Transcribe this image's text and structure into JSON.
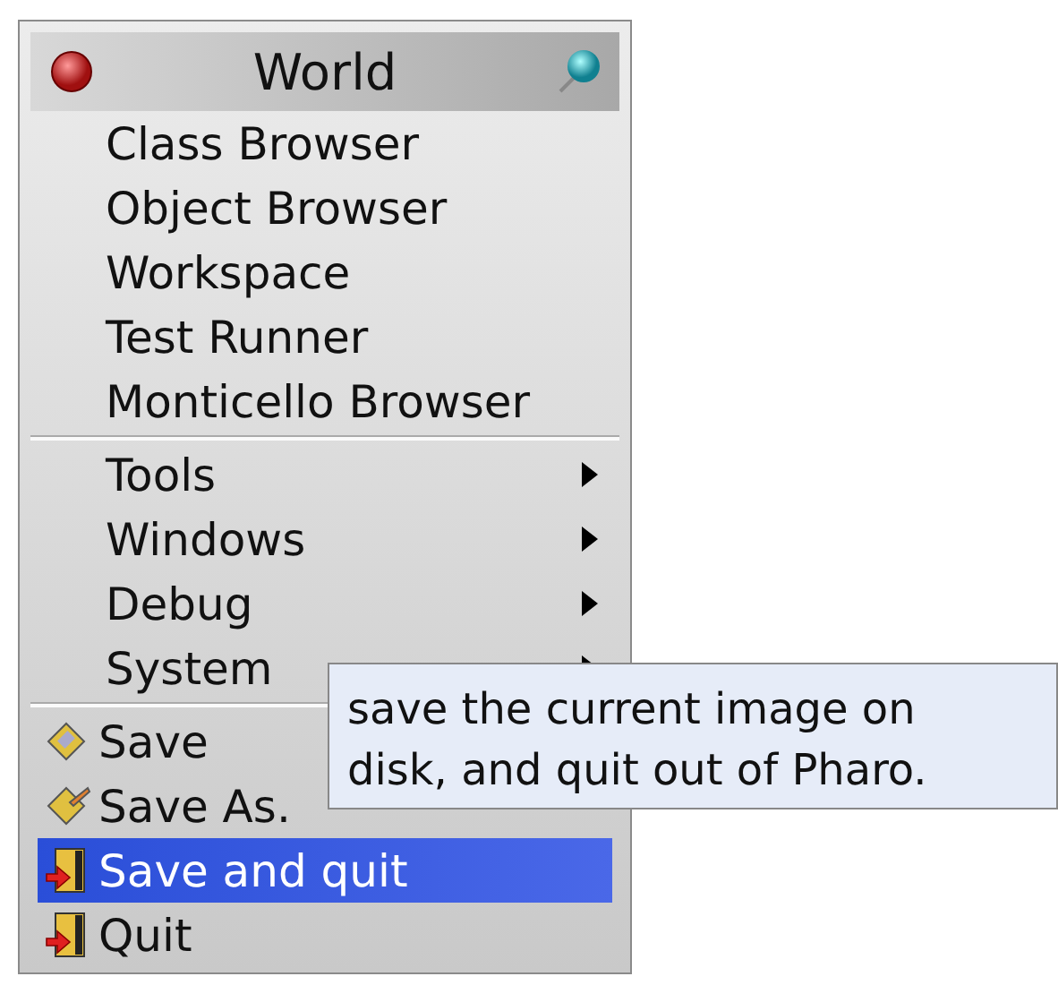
{
  "menu": {
    "title": "World",
    "groups": [
      {
        "items": [
          {
            "label": "Class Browser",
            "kind": "plain",
            "selected": false
          },
          {
            "label": "Object Browser",
            "kind": "plain",
            "selected": false
          },
          {
            "label": "Workspace",
            "kind": "plain",
            "selected": false
          },
          {
            "label": "Test Runner",
            "kind": "plain",
            "selected": false
          },
          {
            "label": "Monticello Browser",
            "kind": "plain",
            "selected": false
          }
        ]
      },
      {
        "items": [
          {
            "label": "Tools",
            "kind": "submenu",
            "selected": false
          },
          {
            "label": "Windows",
            "kind": "submenu",
            "selected": false
          },
          {
            "label": "Debug",
            "kind": "submenu",
            "selected": false
          },
          {
            "label": "System",
            "kind": "submenu",
            "selected": false
          }
        ]
      },
      {
        "items": [
          {
            "label": "Save",
            "kind": "disk",
            "selected": false
          },
          {
            "label": "Save As.",
            "kind": "disk-pen",
            "selected": false
          },
          {
            "label": "Save and quit",
            "kind": "door",
            "selected": true
          },
          {
            "label": "Quit",
            "kind": "door",
            "selected": false
          }
        ]
      }
    ]
  },
  "tooltip": {
    "lines": [
      "save the current image on",
      "disk, and quit out of Pharo."
    ]
  }
}
